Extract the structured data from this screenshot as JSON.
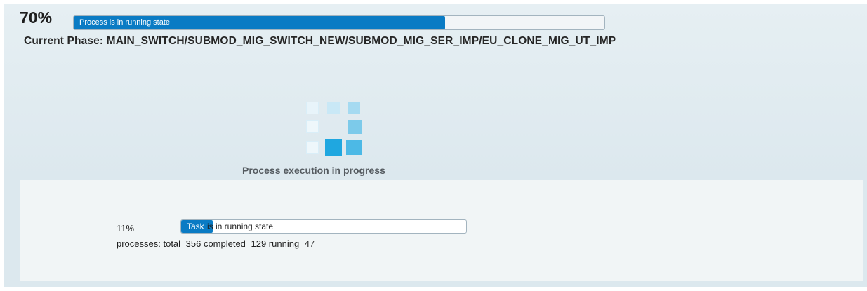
{
  "overall": {
    "percent_text": "70%",
    "progress_fraction": 0.7,
    "bar_label": "Process is in running state"
  },
  "phase": {
    "text": "Current Phase: MAIN_SWITCH/SUBMOD_MIG_SWITCH_NEW/SUBMOD_MIG_SER_IMP/EU_CLONE_MIG_UT_IMP"
  },
  "spinner": {
    "icon": "loading-spinner-icon",
    "caption": "Process execution in progress"
  },
  "task": {
    "percent_text": "11%",
    "progress_fraction": 0.11,
    "bar_label_highlight": "Task",
    "bar_label_rest": "is in running state"
  },
  "processes": {
    "text": "processes: total=356 completed=129 running=47"
  },
  "colors": {
    "accent": "#0a7bc4",
    "spinner_light": "#c9e8f6",
    "spinner_mid": "#7ccaea",
    "spinner_dark": "#1fa7e0"
  }
}
